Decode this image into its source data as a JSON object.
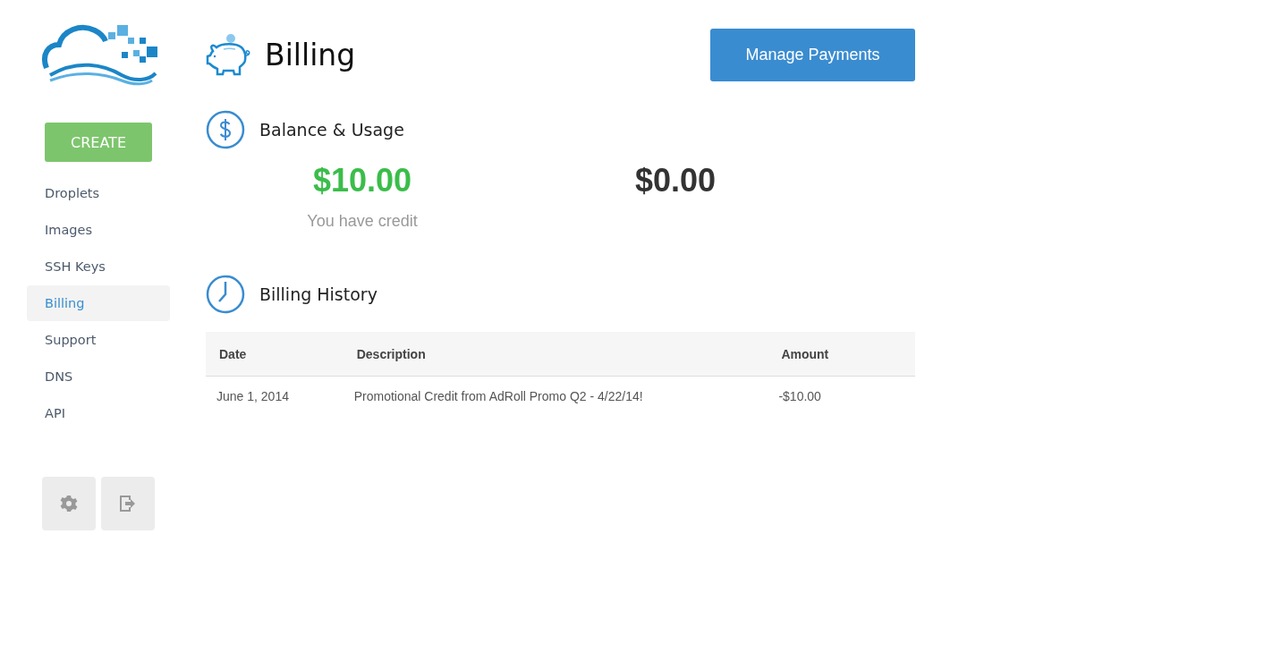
{
  "sidebar": {
    "create_button": "CREATE",
    "items": [
      {
        "label": "Droplets",
        "selected": false
      },
      {
        "label": "Images",
        "selected": false
      },
      {
        "label": "SSH Keys",
        "selected": false
      },
      {
        "label": "Billing",
        "selected": true
      },
      {
        "label": "Support",
        "selected": false
      },
      {
        "label": "DNS",
        "selected": false
      },
      {
        "label": "API",
        "selected": false
      }
    ]
  },
  "page": {
    "title": "Billing",
    "action_button": "Manage Payments"
  },
  "balance": {
    "heading": "Balance & Usage",
    "figures": [
      {
        "kind": "credit",
        "amount": "$10.00",
        "caption": "You have credit"
      },
      {
        "kind": "due",
        "amount": "$0.00"
      }
    ]
  },
  "history": {
    "heading": "Billing History",
    "columns": [
      "Date",
      "Description",
      "Amount"
    ],
    "rows": [
      [
        "June 1, 2014",
        "Promotional Credit from AdRoll Promo Q2 - 4/22/14!",
        "-$10.00"
      ]
    ]
  }
}
